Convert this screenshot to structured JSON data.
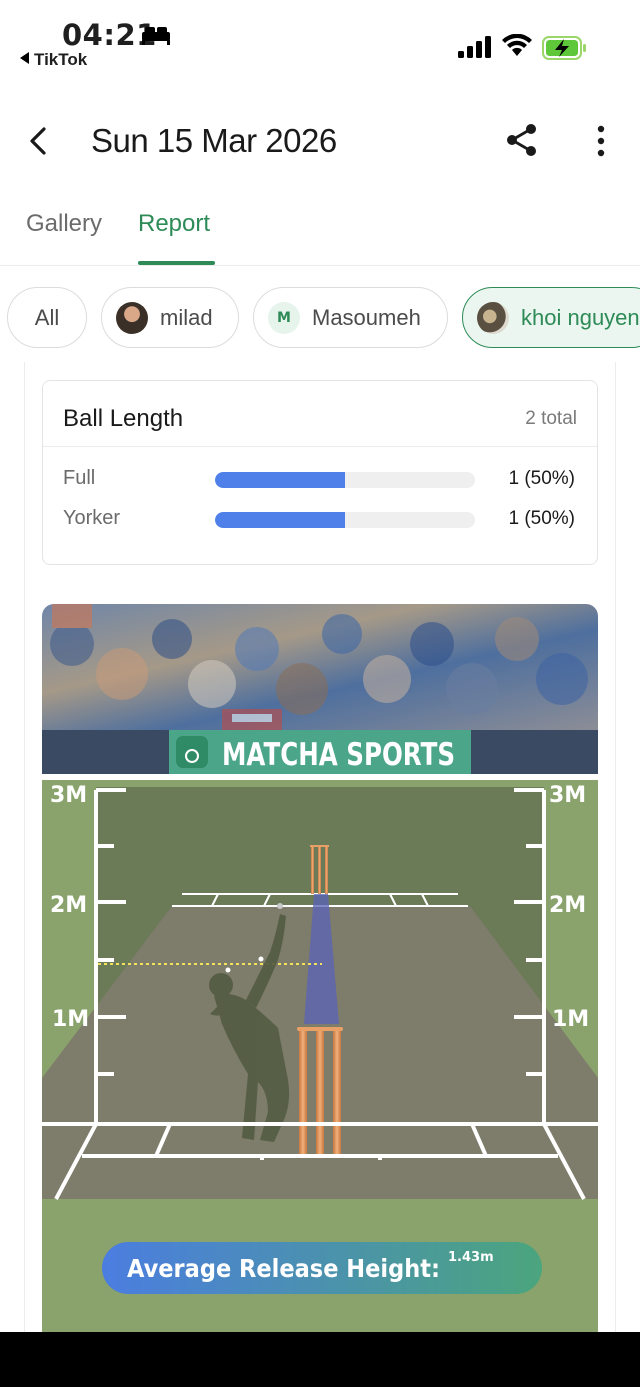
{
  "status_bar": {
    "time": "04:21",
    "back_app": "TikTok"
  },
  "header": {
    "title": "Sun 15 Mar 2026"
  },
  "tabs": [
    {
      "label": "Gallery",
      "active": false
    },
    {
      "label": "Report",
      "active": true
    }
  ],
  "chips": {
    "all": "All",
    "milad": "milad",
    "masoumeh": "Masoumeh",
    "masoumeh_initial": "M",
    "khoi": "khoi nguyen"
  },
  "ball_length": {
    "title": "Ball Length",
    "total": "2 total",
    "rows": [
      {
        "label": "Full",
        "fraction": 0.5,
        "value": "1 (50%)"
      },
      {
        "label": "Yorker",
        "fraction": 0.5,
        "value": "1 (50%)"
      }
    ]
  },
  "graphic": {
    "brand": "MATCHA SPORTS",
    "left_scale": [
      "3M",
      "2M",
      "1M"
    ],
    "right_scale": [
      "3M",
      "2M",
      "1M"
    ],
    "avg_label": "Average Release Height:",
    "avg_value": "1.43m"
  },
  "colors": {
    "accent": "#2e8b57",
    "bar": "#4f7fe8",
    "field": "#8aa36c",
    "pitch": "#7b7b66"
  }
}
